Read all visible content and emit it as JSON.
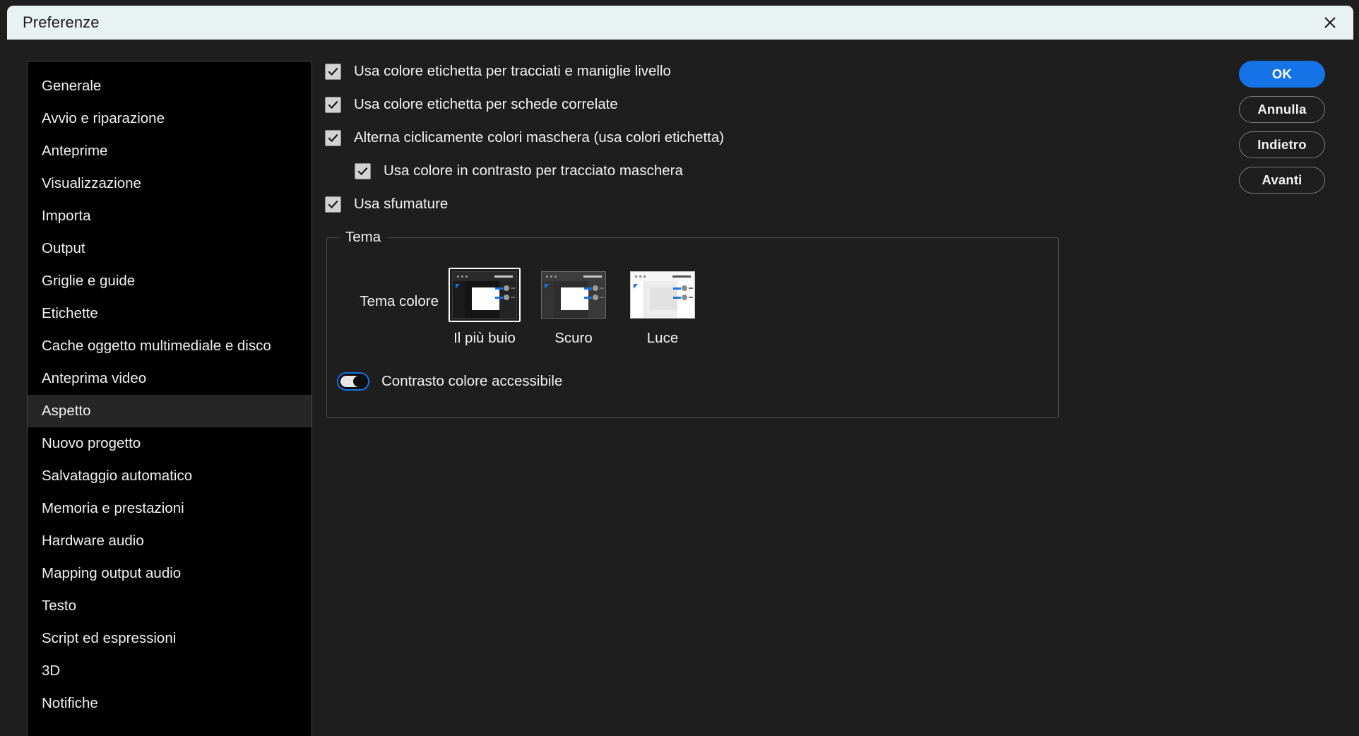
{
  "window": {
    "title": "Preferenze",
    "close_icon": "close-icon"
  },
  "sidebar": {
    "selected": "Aspetto",
    "items": [
      {
        "label": "Generale"
      },
      {
        "label": "Avvio e riparazione"
      },
      {
        "label": "Anteprime"
      },
      {
        "label": "Visualizzazione"
      },
      {
        "label": "Importa"
      },
      {
        "label": "Output"
      },
      {
        "label": "Griglie e guide"
      },
      {
        "label": "Etichette"
      },
      {
        "label": "Cache oggetto multimediale e disco"
      },
      {
        "label": "Anteprima video"
      },
      {
        "label": "Aspetto"
      },
      {
        "label": "Nuovo progetto"
      },
      {
        "label": "Salvataggio automatico"
      },
      {
        "label": "Memoria e prestazioni"
      },
      {
        "label": "Hardware audio"
      },
      {
        "label": "Mapping output audio"
      },
      {
        "label": "Testo"
      },
      {
        "label": "Script ed espressioni"
      },
      {
        "label": "3D"
      },
      {
        "label": "Notifiche"
      }
    ]
  },
  "main": {
    "checkboxes": [
      {
        "label": "Usa colore etichetta per tracciati e maniglie livello",
        "checked": true,
        "indent": false
      },
      {
        "label": "Usa colore etichetta per schede correlate",
        "checked": true,
        "indent": false
      },
      {
        "label": "Alterna ciclicamente colori maschera (usa colori etichetta)",
        "checked": true,
        "indent": false
      },
      {
        "label": "Usa colore in contrasto per tracciato maschera",
        "checked": true,
        "indent": true
      },
      {
        "label": "Usa sfumature",
        "checked": true,
        "indent": false
      }
    ],
    "theme_group": {
      "legend": "Tema",
      "caption": "Tema colore",
      "selected_theme": "Il più buio",
      "themes": [
        {
          "label": "Il più buio",
          "variant": "t-darkest",
          "selected": true
        },
        {
          "label": "Scuro",
          "variant": "t-dark",
          "selected": false
        },
        {
          "label": "Luce",
          "variant": "t-light",
          "selected": false
        }
      ],
      "toggle": {
        "label": "Contrasto colore accessibile",
        "on": true,
        "accent": "#1473e6"
      }
    }
  },
  "buttons": [
    {
      "label": "OK",
      "primary": true
    },
    {
      "label": "Annulla",
      "primary": false
    },
    {
      "label": "Indietro",
      "primary": false
    },
    {
      "label": "Avanti",
      "primary": false
    }
  ],
  "colors": {
    "accent": "#1473e6",
    "window_bg": "#1e1e1e",
    "titlebar_bg": "#e9f2f2",
    "sidebar_bg": "#000000",
    "selected_row": "#262626"
  }
}
